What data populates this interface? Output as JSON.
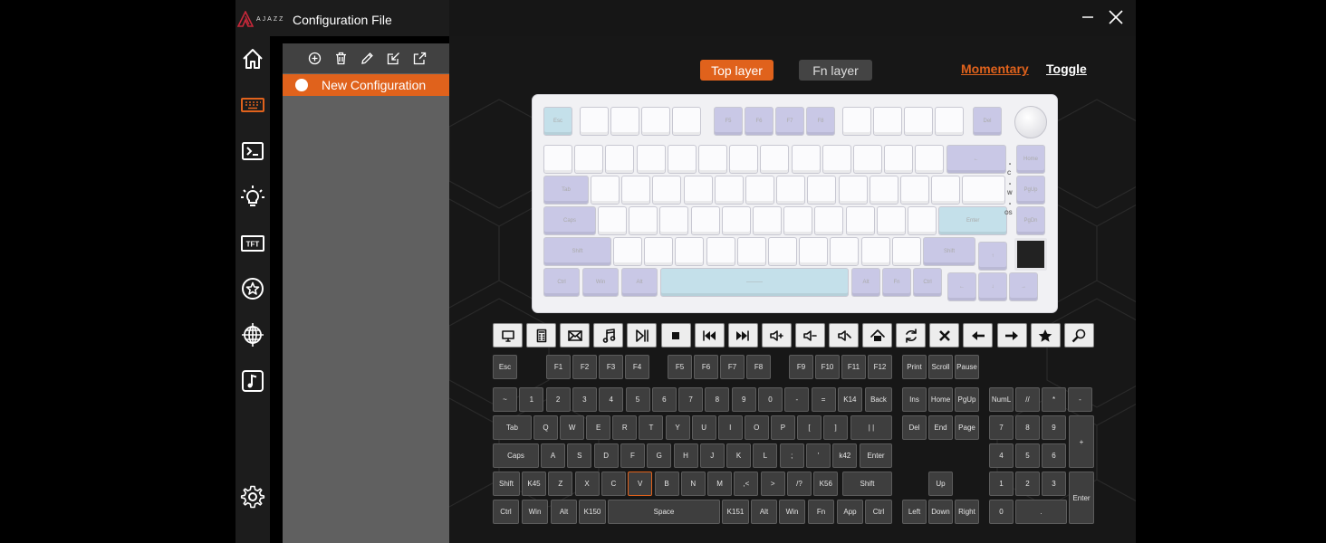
{
  "app": {
    "brand": "AJAZZ",
    "title": "Configuration File",
    "colors": {
      "accent": "#e0621c",
      "background": "#000000",
      "panel": "#606060",
      "key": "#3e3e3e"
    }
  },
  "sidebar": {
    "items": [
      {
        "name": "home-icon",
        "icon": "house"
      },
      {
        "name": "keyboard-icon",
        "icon": "keyboard",
        "active": true
      },
      {
        "name": "terminal-icon",
        "icon": "terminal"
      },
      {
        "name": "lightbulb-icon",
        "icon": "light"
      },
      {
        "name": "tft-icon",
        "icon": "tft",
        "label": "TFT"
      },
      {
        "name": "star-icon",
        "icon": "star-circle"
      },
      {
        "name": "globe-icon",
        "icon": "globe"
      },
      {
        "name": "music-icon",
        "icon": "music"
      }
    ],
    "settings_icon": "gear"
  },
  "config_panel": {
    "toolbar": [
      "add-icon",
      "trash-icon",
      "pencil-icon",
      "import-icon",
      "export-icon"
    ],
    "items": [
      {
        "label": "New Configuration",
        "selected": true
      }
    ]
  },
  "layers": {
    "top": "Top layer",
    "fn": "Fn layer",
    "active": "top"
  },
  "modes": {
    "momentary": "Momentary",
    "toggle": "Toggle",
    "active": "momentary"
  },
  "function_icons": [
    "monitor-icon",
    "calculator-icon",
    "mail-icon",
    "music-note-icon",
    "play-pause-icon",
    "stop-icon",
    "previous-track-icon",
    "next-track-icon",
    "volume-up-icon",
    "volume-down-icon",
    "mute-icon",
    "home-page-icon",
    "refresh-icon",
    "close-icon",
    "back-arrow-icon",
    "forward-arrow-icon",
    "favorites-icon",
    "search-icon"
  ],
  "key_rows": {
    "row0": [
      "Esc",
      "F1",
      "F2",
      "F3",
      "F4",
      "F5",
      "F6",
      "F7",
      "F8",
      "F9",
      "F10",
      "F11",
      "F12",
      "Print",
      "Scroll",
      "Pause"
    ],
    "row1": [
      "~",
      "1",
      "2",
      "3",
      "4",
      "5",
      "6",
      "7",
      "8",
      "9",
      "0",
      "-",
      "=",
      "K14",
      "Back",
      "Ins",
      "Home",
      "PgUp",
      "NumL",
      "//",
      "*",
      "-"
    ],
    "row2": [
      "Tab",
      "Q",
      "W",
      "E",
      "R",
      "T",
      "Y",
      "U",
      "I",
      "O",
      "P",
      "[",
      "]",
      "| |",
      "Del",
      "End",
      "Page",
      "7",
      "8",
      "9",
      "+"
    ],
    "row3": [
      "Caps",
      "A",
      "S",
      "D",
      "F",
      "G",
      "H",
      "J",
      "K",
      "L",
      ";",
      "'",
      "k42",
      "Enter",
      "4",
      "5",
      "6"
    ],
    "row4": [
      "Shift",
      "K45",
      "Z",
      "X",
      "C",
      "V",
      "B",
      "N",
      "M",
      ",<",
      ">",
      "/?",
      "K56",
      "Shift",
      "Up",
      "1",
      "2",
      "3",
      "Enter"
    ],
    "row5": [
      "Ctrl",
      "Win",
      "Alt",
      "K150",
      "Space",
      "K151",
      "Alt",
      "Win",
      "Fn",
      "App",
      "Ctrl",
      "Left",
      "Down",
      "Right",
      "0",
      "."
    ]
  },
  "selected_key": "V",
  "keyboard_image": {
    "legends": [
      "Esc",
      "F5",
      "F6",
      "F7",
      "F8",
      "Del",
      "Home",
      "PgUp",
      "PgDn",
      "Tab",
      "Caps",
      "Enter",
      "Shift",
      "Ctrl",
      "Win",
      "Alt",
      "Fn"
    ],
    "indicators": [
      "C",
      "W",
      "OS"
    ]
  }
}
